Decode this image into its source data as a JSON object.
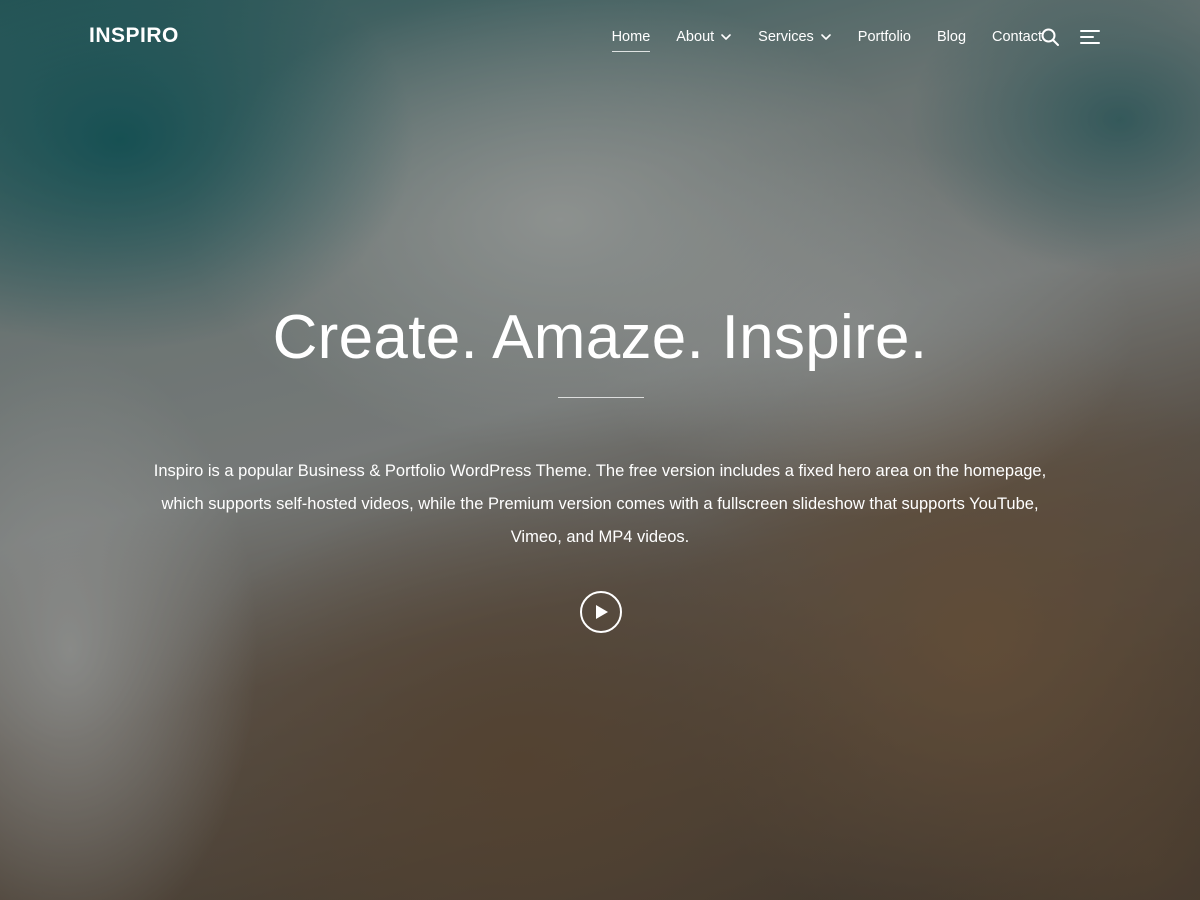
{
  "header": {
    "logo": "INSPIRO",
    "nav": [
      {
        "label": "Home",
        "active": true,
        "has_dropdown": false
      },
      {
        "label": "About",
        "active": false,
        "has_dropdown": true
      },
      {
        "label": "Services",
        "active": false,
        "has_dropdown": true
      },
      {
        "label": "Portfolio",
        "active": false,
        "has_dropdown": false
      },
      {
        "label": "Blog",
        "active": false,
        "has_dropdown": false
      },
      {
        "label": "Contact",
        "active": false,
        "has_dropdown": false
      }
    ],
    "icons": {
      "search": "search-icon",
      "menu": "menu-icon",
      "dropdown": "chevron-down-icon"
    }
  },
  "hero": {
    "title": "Create. Amaze. Inspire.",
    "description": "Inspiro is a popular Business & Portfolio WordPress Theme. The free version includes a fixed hero area on the homepage, which supports self-hosted videos, while the Premium version comes with a fullscreen slideshow that supports YouTube, Vimeo, and MP4 videos.",
    "play_icon": "play-icon"
  },
  "colors": {
    "text": "#ffffff",
    "overlay": "rgba(0,0,0,0.30)"
  }
}
